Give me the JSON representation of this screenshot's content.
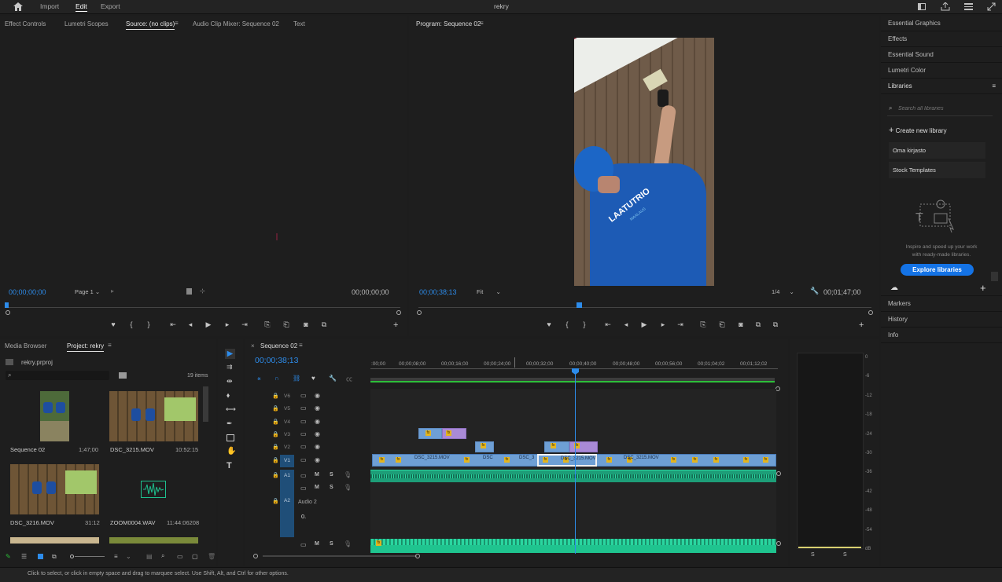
{
  "topbar": {
    "import": "Import",
    "edit": "Edit",
    "export": "Export",
    "project_title": "rekry"
  },
  "source": {
    "tabs": [
      "Effect Controls",
      "Lumetri Scopes",
      "Source: (no clips)",
      "Audio Clip Mixer: Sequence 02",
      "Text"
    ],
    "timecode_left": "00;00;00;00",
    "page": "Page 1",
    "timecode_right": "00;00;00;00"
  },
  "program": {
    "title": "Program: Sequence 02",
    "timecode": "00;00;38;13",
    "fit": "Fit",
    "ratio": "1/4",
    "duration": "00;01;47;00",
    "shirt_text": "LAATUTRIO",
    "shirt_subtext": "MAALAUS"
  },
  "right_panel": {
    "items": [
      "Essential Graphics",
      "Effects",
      "Essential Sound",
      "Lumetri Color",
      "Libraries"
    ],
    "search_placeholder": "Search all libraries",
    "create_library": "Create new library",
    "libraries": [
      "Oma kirjasto",
      "Stock Templates"
    ],
    "promo_line1": "Inspire and speed up your work",
    "promo_line2": "with ready-made libraries.",
    "explore_button": "Explore libraries",
    "bottom_items": [
      "Markers",
      "History",
      "Info"
    ]
  },
  "project": {
    "tabs": [
      "Media Browser",
      "Project: rekry"
    ],
    "file": "rekry.prproj",
    "items_count": "19 items",
    "items": [
      {
        "name": "Sequence 02",
        "duration": "1;47;00"
      },
      {
        "name": "DSC_3215.MOV",
        "duration": "10:52:15"
      },
      {
        "name": "DSC_3216.MOV",
        "duration": "31:12"
      },
      {
        "name": "ZOOM0004.WAV",
        "duration": "11:44:06208"
      }
    ]
  },
  "timeline": {
    "tab": "Sequence 02",
    "timecode": "00;00;38;13",
    "ruler": [
      ":00;00",
      "00;00;08;00",
      "00;00;16;00",
      "00;00;24;00",
      "00;00;32;00",
      "00;00;40;00",
      "00;00;48;00",
      "00;00;56;00",
      "00;01;04;02",
      "00;01;12;02"
    ],
    "video_tracks": [
      "V6",
      "V5",
      "V4",
      "V3",
      "V2",
      "V1"
    ],
    "audio_tracks": [
      "A1",
      "A2"
    ],
    "audio2_label": "Audio 2",
    "audio2_volume": "0.",
    "clip_labels": [
      "DSC_3215.MOV",
      "DSC",
      "DSC_3",
      "DSC_3215.MOV",
      "DSC_3215.MOV"
    ]
  },
  "meters": {
    "labels": [
      "0",
      "-6",
      "-12",
      "-18",
      "-24",
      "-30",
      "-36",
      "-42",
      "-48",
      "-54",
      "dB"
    ],
    "solo": [
      "S",
      "S"
    ]
  },
  "status_bar": {
    "text": "Click to select, or click in empty space and drag to marquee select. Use Shift, Alt, and Ctrl for other options."
  }
}
